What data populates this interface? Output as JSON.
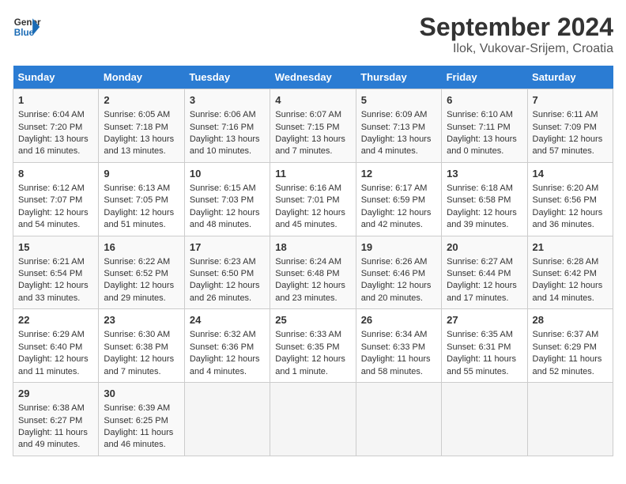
{
  "header": {
    "logo_line1": "General",
    "logo_line2": "Blue",
    "title": "September 2024",
    "subtitle": "Ilok, Vukovar-Srijem, Croatia"
  },
  "weekdays": [
    "Sunday",
    "Monday",
    "Tuesday",
    "Wednesday",
    "Thursday",
    "Friday",
    "Saturday"
  ],
  "weeks": [
    [
      {
        "day": "1",
        "lines": [
          "Sunrise: 6:04 AM",
          "Sunset: 7:20 PM",
          "Daylight: 13 hours",
          "and 16 minutes."
        ]
      },
      {
        "day": "2",
        "lines": [
          "Sunrise: 6:05 AM",
          "Sunset: 7:18 PM",
          "Daylight: 13 hours",
          "and 13 minutes."
        ]
      },
      {
        "day": "3",
        "lines": [
          "Sunrise: 6:06 AM",
          "Sunset: 7:16 PM",
          "Daylight: 13 hours",
          "and 10 minutes."
        ]
      },
      {
        "day": "4",
        "lines": [
          "Sunrise: 6:07 AM",
          "Sunset: 7:15 PM",
          "Daylight: 13 hours",
          "and 7 minutes."
        ]
      },
      {
        "day": "5",
        "lines": [
          "Sunrise: 6:09 AM",
          "Sunset: 7:13 PM",
          "Daylight: 13 hours",
          "and 4 minutes."
        ]
      },
      {
        "day": "6",
        "lines": [
          "Sunrise: 6:10 AM",
          "Sunset: 7:11 PM",
          "Daylight: 13 hours",
          "and 0 minutes."
        ]
      },
      {
        "day": "7",
        "lines": [
          "Sunrise: 6:11 AM",
          "Sunset: 7:09 PM",
          "Daylight: 12 hours",
          "and 57 minutes."
        ]
      }
    ],
    [
      {
        "day": "8",
        "lines": [
          "Sunrise: 6:12 AM",
          "Sunset: 7:07 PM",
          "Daylight: 12 hours",
          "and 54 minutes."
        ]
      },
      {
        "day": "9",
        "lines": [
          "Sunrise: 6:13 AM",
          "Sunset: 7:05 PM",
          "Daylight: 12 hours",
          "and 51 minutes."
        ]
      },
      {
        "day": "10",
        "lines": [
          "Sunrise: 6:15 AM",
          "Sunset: 7:03 PM",
          "Daylight: 12 hours",
          "and 48 minutes."
        ]
      },
      {
        "day": "11",
        "lines": [
          "Sunrise: 6:16 AM",
          "Sunset: 7:01 PM",
          "Daylight: 12 hours",
          "and 45 minutes."
        ]
      },
      {
        "day": "12",
        "lines": [
          "Sunrise: 6:17 AM",
          "Sunset: 6:59 PM",
          "Daylight: 12 hours",
          "and 42 minutes."
        ]
      },
      {
        "day": "13",
        "lines": [
          "Sunrise: 6:18 AM",
          "Sunset: 6:58 PM",
          "Daylight: 12 hours",
          "and 39 minutes."
        ]
      },
      {
        "day": "14",
        "lines": [
          "Sunrise: 6:20 AM",
          "Sunset: 6:56 PM",
          "Daylight: 12 hours",
          "and 36 minutes."
        ]
      }
    ],
    [
      {
        "day": "15",
        "lines": [
          "Sunrise: 6:21 AM",
          "Sunset: 6:54 PM",
          "Daylight: 12 hours",
          "and 33 minutes."
        ]
      },
      {
        "day": "16",
        "lines": [
          "Sunrise: 6:22 AM",
          "Sunset: 6:52 PM",
          "Daylight: 12 hours",
          "and 29 minutes."
        ]
      },
      {
        "day": "17",
        "lines": [
          "Sunrise: 6:23 AM",
          "Sunset: 6:50 PM",
          "Daylight: 12 hours",
          "and 26 minutes."
        ]
      },
      {
        "day": "18",
        "lines": [
          "Sunrise: 6:24 AM",
          "Sunset: 6:48 PM",
          "Daylight: 12 hours",
          "and 23 minutes."
        ]
      },
      {
        "day": "19",
        "lines": [
          "Sunrise: 6:26 AM",
          "Sunset: 6:46 PM",
          "Daylight: 12 hours",
          "and 20 minutes."
        ]
      },
      {
        "day": "20",
        "lines": [
          "Sunrise: 6:27 AM",
          "Sunset: 6:44 PM",
          "Daylight: 12 hours",
          "and 17 minutes."
        ]
      },
      {
        "day": "21",
        "lines": [
          "Sunrise: 6:28 AM",
          "Sunset: 6:42 PM",
          "Daylight: 12 hours",
          "and 14 minutes."
        ]
      }
    ],
    [
      {
        "day": "22",
        "lines": [
          "Sunrise: 6:29 AM",
          "Sunset: 6:40 PM",
          "Daylight: 12 hours",
          "and 11 minutes."
        ]
      },
      {
        "day": "23",
        "lines": [
          "Sunrise: 6:30 AM",
          "Sunset: 6:38 PM",
          "Daylight: 12 hours",
          "and 7 minutes."
        ]
      },
      {
        "day": "24",
        "lines": [
          "Sunrise: 6:32 AM",
          "Sunset: 6:36 PM",
          "Daylight: 12 hours",
          "and 4 minutes."
        ]
      },
      {
        "day": "25",
        "lines": [
          "Sunrise: 6:33 AM",
          "Sunset: 6:35 PM",
          "Daylight: 12 hours",
          "and 1 minute."
        ]
      },
      {
        "day": "26",
        "lines": [
          "Sunrise: 6:34 AM",
          "Sunset: 6:33 PM",
          "Daylight: 11 hours",
          "and 58 minutes."
        ]
      },
      {
        "day": "27",
        "lines": [
          "Sunrise: 6:35 AM",
          "Sunset: 6:31 PM",
          "Daylight: 11 hours",
          "and 55 minutes."
        ]
      },
      {
        "day": "28",
        "lines": [
          "Sunrise: 6:37 AM",
          "Sunset: 6:29 PM",
          "Daylight: 11 hours",
          "and 52 minutes."
        ]
      }
    ],
    [
      {
        "day": "29",
        "lines": [
          "Sunrise: 6:38 AM",
          "Sunset: 6:27 PM",
          "Daylight: 11 hours",
          "and 49 minutes."
        ]
      },
      {
        "day": "30",
        "lines": [
          "Sunrise: 6:39 AM",
          "Sunset: 6:25 PM",
          "Daylight: 11 hours",
          "and 46 minutes."
        ]
      },
      {
        "day": "",
        "lines": []
      },
      {
        "day": "",
        "lines": []
      },
      {
        "day": "",
        "lines": []
      },
      {
        "day": "",
        "lines": []
      },
      {
        "day": "",
        "lines": []
      }
    ]
  ]
}
